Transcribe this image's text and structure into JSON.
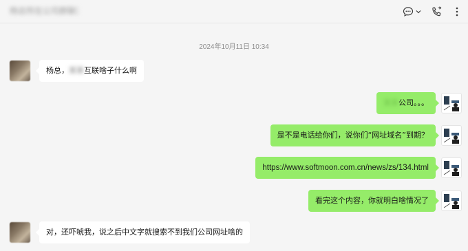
{
  "header": {
    "title": "杨总所在公司群聊天",
    "icons": [
      "chat-options-icon",
      "chevron-down-icon",
      "voice-call-icon",
      "more-icon"
    ]
  },
  "timestamp": "2024年10月11日 10:34",
  "messages": [
    {
      "from": "them",
      "prefix": "杨总，",
      "redacted": "某某",
      "suffix": "互联啥子什么啊"
    },
    {
      "from": "me",
      "redacted": "某某",
      "suffix": "公司。。。"
    },
    {
      "from": "me",
      "text": "是不是电话给你们，说你们“网址域名”到期？"
    },
    {
      "from": "me",
      "text": "https://www.softmoon.com.cn/news/zs/134.html"
    },
    {
      "from": "me",
      "text": "看完这个内容，你就明白啥情况了"
    },
    {
      "from": "them",
      "text": "对，还吓唬我，说之后中文字就搜索不到我们公司网址啥的"
    }
  ],
  "colors": {
    "background": "#f5f5f5",
    "my_bubble": "#95ec69",
    "their_bubble": "#ffffff",
    "timestamp": "#8c8c8c"
  }
}
